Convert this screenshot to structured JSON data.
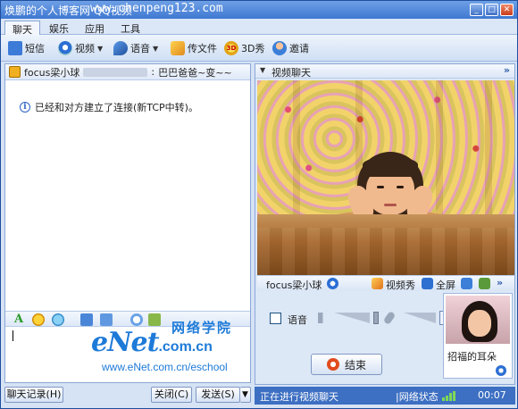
{
  "window": {
    "title": "焕鹏的个人博客网 QQ视频",
    "watermark": "www.chenpeng123.com",
    "controls": [
      "minimize",
      "maximize",
      "close"
    ]
  },
  "menu_tabs": [
    "聊天",
    "娱乐",
    "应用",
    "工具"
  ],
  "toolbar": {
    "sms": "短信",
    "video": "视频",
    "voice": "语音",
    "file": "传文件",
    "show3d": "3D秀",
    "invite": "邀请",
    "icon_3d_text": "3D"
  },
  "chat": {
    "contact_name": "focus梁小球",
    "separator": ":",
    "contact_status": "巴巴爸爸~变~~",
    "system_message": "已经和对方建立了连接(新TCP中转)。",
    "info_glyph": "i",
    "font_glyph": "A"
  },
  "watermark_logo": {
    "brand": "eNet",
    "com": ".com.cn",
    "school": "网络学院",
    "url": "www.eNet.com.cn/eschool"
  },
  "buttons": {
    "history": "聊天记录(H)",
    "close": "关闭(C)",
    "send": "发送(S)",
    "send_arrow": "▼"
  },
  "video_panel": {
    "title": "视频聊天",
    "collapse_glyph": "▼",
    "more_glyph": "»",
    "remote_name": "focus梁小球",
    "show_label": "视频秀",
    "fullscreen_label": "全屏",
    "bar_more": "»"
  },
  "voice": {
    "label": "语音",
    "checked": false,
    "more_glyph": "»"
  },
  "end_call": "结束",
  "self_view": {
    "caption": "招福的耳朵"
  },
  "statusbar": {
    "message": "正在进行视频聊天",
    "network_label": "|网络状态",
    "signal_bars": 4,
    "elapsed": "00:07"
  },
  "colors": {
    "frame": "#1f4f9e",
    "accent": "#3d6fc2",
    "panel": "#d6e3f5",
    "logo_blue": "#1d7ad8"
  }
}
